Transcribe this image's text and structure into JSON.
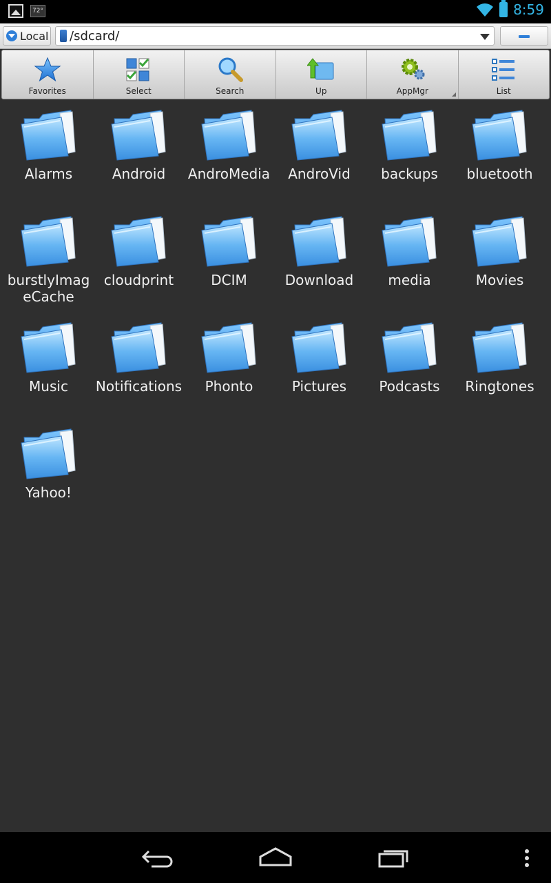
{
  "status_bar": {
    "notification_icon": "image-icon",
    "temp_badge": "72°",
    "wifi_icon": "wifi-icon",
    "battery_icon": "battery-icon",
    "clock": "8:59",
    "accent": "#33b5e5"
  },
  "location_bar": {
    "source_label": "Local",
    "path": "/sdcard/",
    "collapse_icon": "minus-icon"
  },
  "toolbar": [
    {
      "label": "Favorites",
      "icon": "star-icon"
    },
    {
      "label": "Select",
      "icon": "checklist-icon"
    },
    {
      "label": "Search",
      "icon": "magnifier-icon"
    },
    {
      "label": "Up",
      "icon": "up-folder-icon"
    },
    {
      "label": "AppMgr",
      "icon": "gears-icon"
    },
    {
      "label": "List",
      "icon": "list-icon"
    }
  ],
  "folders": [
    "Alarms",
    "Android",
    "AndroMedia",
    "AndroVid",
    "backups",
    "bluetooth",
    "burstlyImageCache",
    "cloudprint",
    "DCIM",
    "Download",
    "media",
    "Movies",
    "Music",
    "Notifications",
    "Phonto",
    "Pictures",
    "Podcasts",
    "Ringtones",
    "Yahoo!"
  ],
  "nav_bar": {
    "back_icon": "back-icon",
    "home_icon": "home-icon",
    "recent_icon": "recent-apps-icon",
    "menu_icon": "overflow-menu-icon"
  }
}
